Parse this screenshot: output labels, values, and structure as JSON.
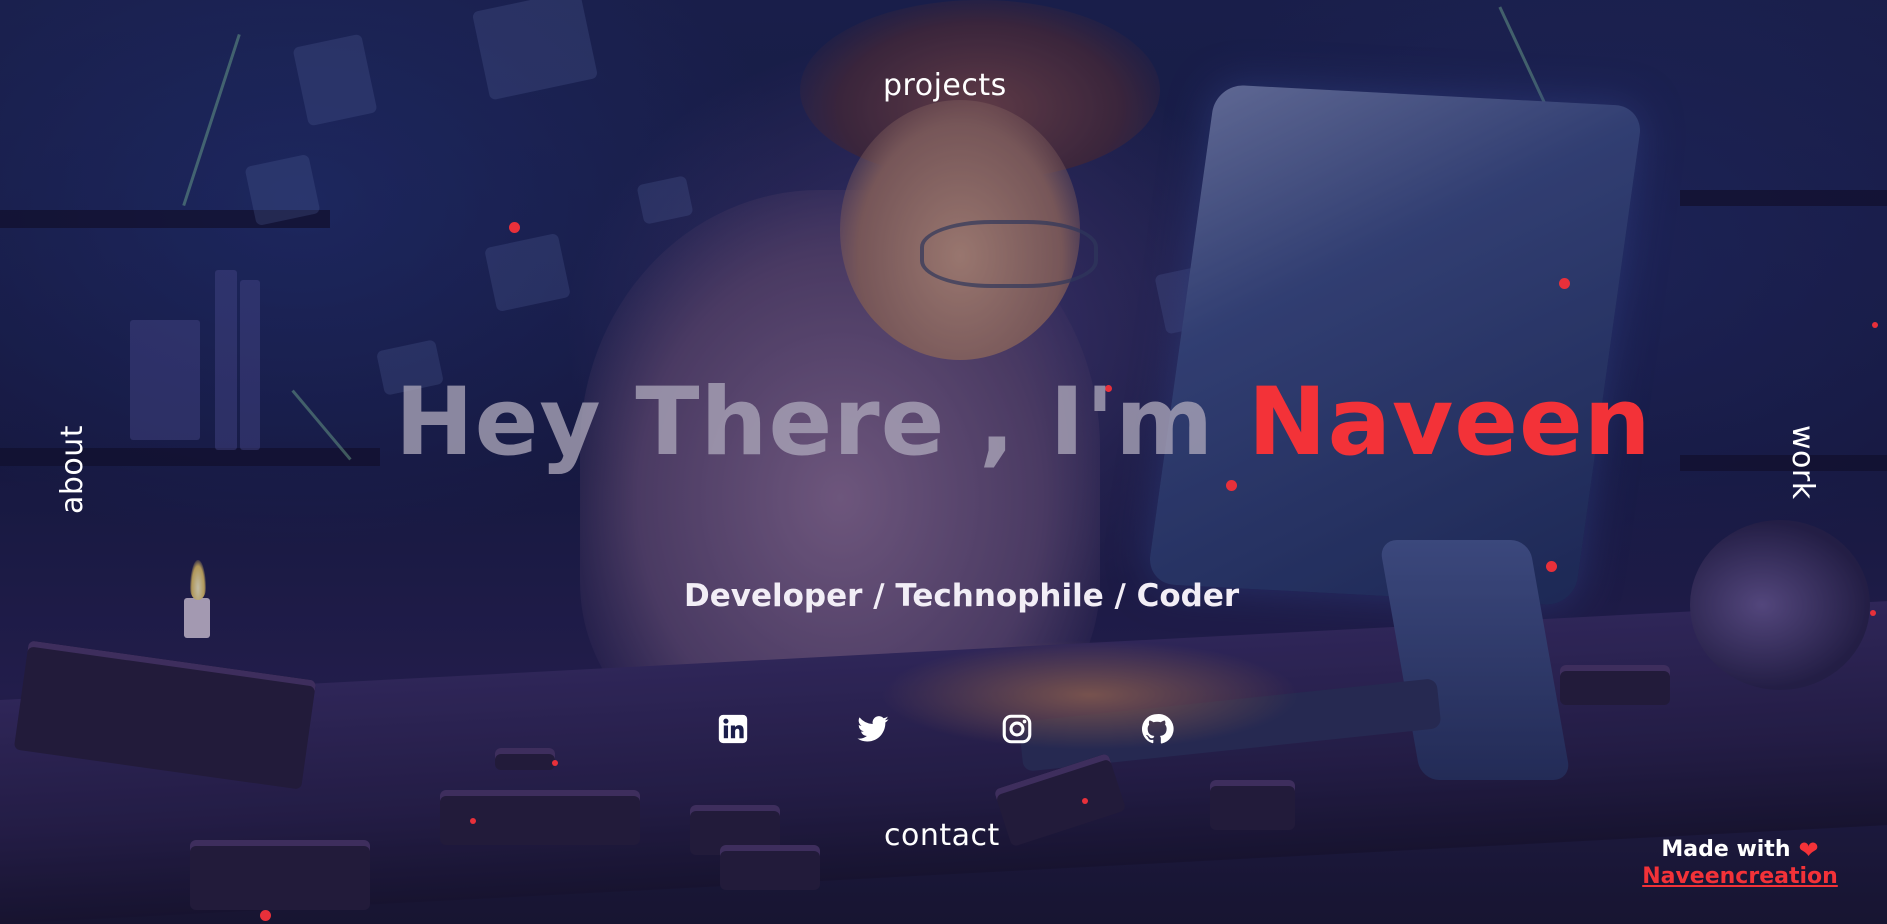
{
  "nav": {
    "projects": "projects",
    "about": "about",
    "work": "work",
    "contact": "contact"
  },
  "hero": {
    "greeting": "Hey There , I'm",
    "name": "Naveen"
  },
  "tagline": "Developer / Technophile / Coder",
  "socials": [
    {
      "icon": "linkedin-icon"
    },
    {
      "icon": "twitter-icon"
    },
    {
      "icon": "instagram-icon"
    },
    {
      "icon": "github-icon"
    }
  ],
  "footer": {
    "made_with": "Made with",
    "heart": "❤",
    "author": "Naveencreation"
  },
  "colors": {
    "accent": "#f33238",
    "text": "#ffffff",
    "greeting": "#aaa5b9",
    "background": "#1a1d4a"
  }
}
